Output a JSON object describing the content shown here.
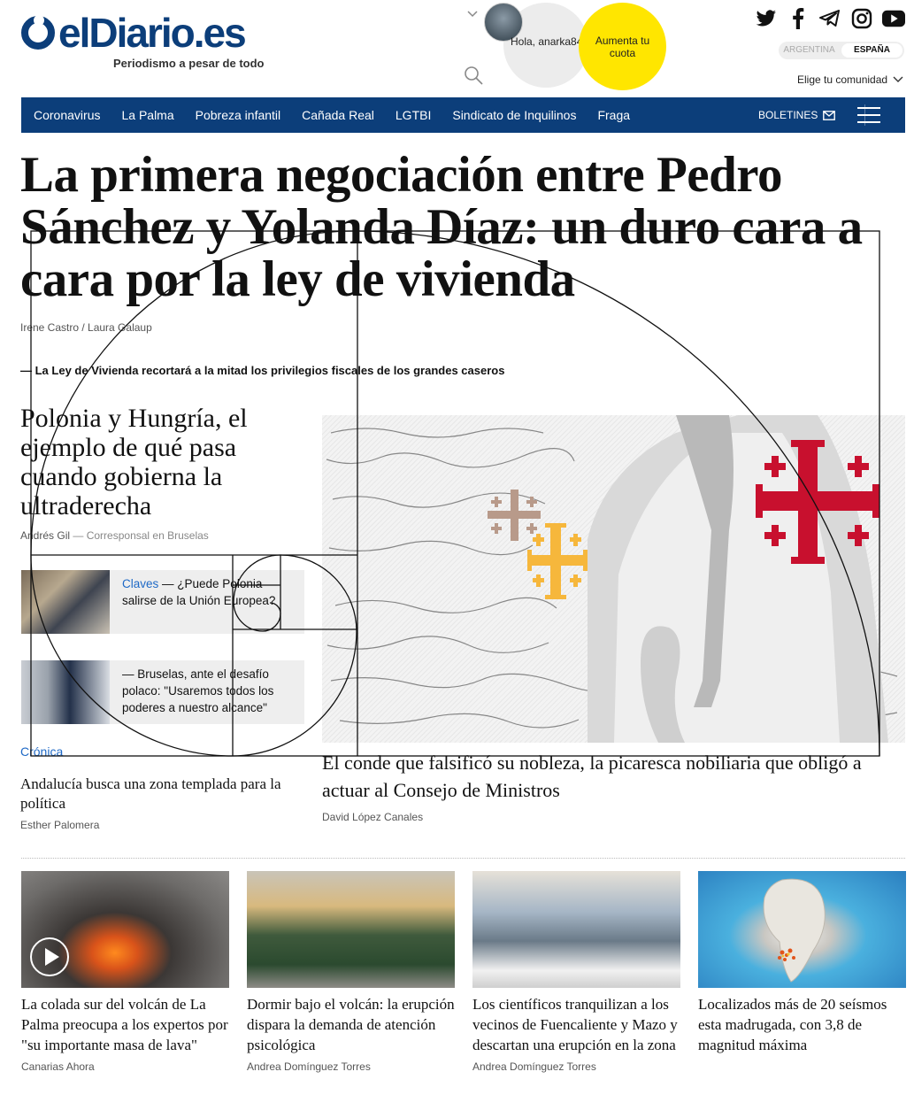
{
  "header": {
    "logo_text": "elDiario.es",
    "tagline": "Periodismo a pesar de todo",
    "greeting": "Hola, anarka84",
    "cuota_label": "Aumenta tu cuota",
    "country": {
      "option_1": "ARGENTINA",
      "option_2": "ESPAÑA",
      "selected": "ESPAÑA"
    },
    "community_label": "Elige tu comunidad",
    "social_icons": [
      "twitter-icon",
      "facebook-icon",
      "telegram-icon",
      "instagram-icon",
      "youtube-icon"
    ]
  },
  "nav": {
    "items": [
      "Coronavirus",
      "La Palma",
      "Pobreza infantil",
      "Cañada Real",
      "LGTBI",
      "Sindicato de Inquilinos",
      "Fraga"
    ],
    "boletines_label": "BOLETINES",
    "accent": "#0c3e7a"
  },
  "lead": {
    "headline": "La primera negociación entre Pedro Sánchez y Yolanda Díaz: un duro cara a cara por la ley de vivienda",
    "authors": "Irene Castro / Laura Galaup",
    "related": "— La Ley de Vivienda recortará a la mitad los privilegios fiscales de los grandes caseros"
  },
  "left_story": {
    "title": "Polonia y Hungría, el ejemplo de qué pasa cuando gobierna la ultraderecha",
    "author": "Andrés Gil",
    "role": "— Corresponsal en Bruselas",
    "mini_1": {
      "tag": "Claves",
      "text": " — ¿Puede Polonia salirse de la Unión Europea?"
    },
    "mini_2": {
      "text": "— Bruselas, ante el desafío polaco: \"Usaremos todos los poderes a nuestro alcance\""
    }
  },
  "cronica": {
    "section": "Crónica",
    "title": "Andalucía busca una zona templada para la política",
    "author": "Esther Palomera"
  },
  "featured": {
    "caption": "El conde que falsificó su nobleza, la picaresca nobiliaria que obligó a actuar al Consejo de Ministros",
    "author": "David López Canales",
    "image_icon": "jerusalem-cross-icon"
  },
  "cards": [
    {
      "title": "La colada sur del volcán de La Palma preocupa a los expertos por \"su importante masa de lava\"",
      "by": "Canarias Ahora"
    },
    {
      "title": "Dormir bajo el volcán: la erupción dispara la demanda de atención psicológica",
      "by": "Andrea Domínguez Torres"
    },
    {
      "title": "Los científicos tranquilizan a los vecinos de Fuencaliente y Mazo y descartan una erupción en la zona",
      "by": "Andrea Domínguez Torres"
    },
    {
      "title": "Localizados más de 20 seísmos esta madrugada, con 3,8 de magnitud máxima",
      "by": ""
    }
  ],
  "colors": {
    "link": "#1e69c6",
    "cuota_bg": "#ffe600",
    "cross_red": "#c8102e"
  }
}
